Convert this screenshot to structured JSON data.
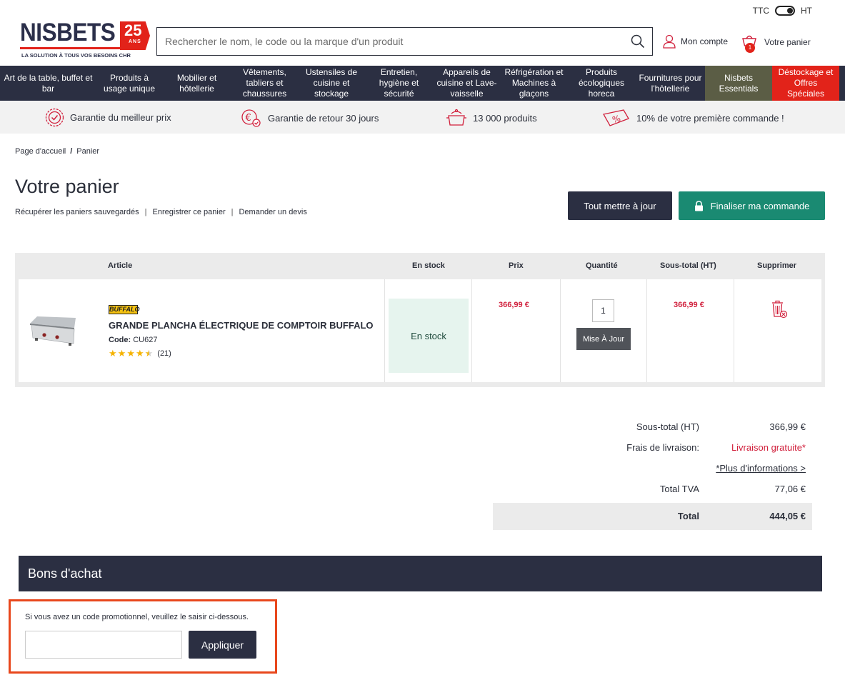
{
  "header": {
    "tax_ttc": "TTC",
    "tax_ht": "HT",
    "logo_word": "NISBETS",
    "logo_badge_number": "25",
    "logo_badge_text": "ANS",
    "logo_tagline": "LA SOLUTION À TOUS VOS BESOINS CHR",
    "search_placeholder": "Rechercher le nom, le code ou la marque d'un produit",
    "account_label": "Mon compte",
    "cart_label": "Votre panier",
    "cart_count": "1"
  },
  "nav": {
    "items": [
      {
        "label": "Art de la table, buffet et bar"
      },
      {
        "label": "Produits à usage unique"
      },
      {
        "label": "Mobilier et hôtellerie"
      },
      {
        "label": "Vêtements, tabliers et chaussures"
      },
      {
        "label": "Ustensiles de cuisine et stockage"
      },
      {
        "label": "Entretien, hygiène et sécurité"
      },
      {
        "label": "Appareils de cuisine et Lave-vaisselle"
      },
      {
        "label": "Réfrigération et Machines à glaçons"
      },
      {
        "label": "Produits écologiques horeca"
      },
      {
        "label": "Fournitures pour l'hôtellerie"
      },
      {
        "label": "Nisbets Essentials"
      },
      {
        "label": "Déstockage et Offres Spéciales"
      }
    ]
  },
  "usp": [
    {
      "label": "Garantie du meilleur prix",
      "icon": "badge-check-icon"
    },
    {
      "label": "Garantie de retour 30 jours",
      "icon": "euro-return-icon"
    },
    {
      "label": "13 000 produits",
      "icon": "pot-icon"
    },
    {
      "label": "10% de votre première commande !",
      "icon": "percent-tag-icon"
    }
  ],
  "breadcrumb": {
    "home": "Page d'accueil",
    "sep": "/",
    "current": "Panier"
  },
  "page": {
    "title": "Votre panier",
    "link_saved": "Récupérer les paniers sauvegardés",
    "link_save": "Enregistrer ce panier",
    "link_quote": "Demander un devis",
    "link_sep": "|",
    "btn_update_all": "Tout mettre à jour",
    "btn_checkout": "Finaliser ma commande"
  },
  "table": {
    "headers": {
      "article": "Article",
      "stock": "En stock",
      "price": "Prix",
      "qty": "Quantité",
      "subtotal": "Sous-total (HT)",
      "remove": "Supprimer"
    },
    "rows": [
      {
        "brand": "BUFFALO",
        "name": "GRANDE PLANCHA ÉLECTRIQUE DE COMPTOIR BUFFALO",
        "code_label": "Code:",
        "code": "CU627",
        "rating": 4.5,
        "reviews": "(21)",
        "stock": "En stock",
        "price": "366,99 €",
        "qty": "1",
        "update_label": "Mise À Jour",
        "subtotal": "366,99 €"
      }
    ]
  },
  "totals": {
    "subtotal_label": "Sous-total (HT)",
    "subtotal_value": "366,99 €",
    "shipping_label": "Frais de livraison:",
    "shipping_value": "Livraison gratuite*",
    "more_info": "*Plus d'informations >",
    "vat_label": "Total TVA",
    "vat_value": "77,06 €",
    "total_label": "Total",
    "total_value": "444,05 €"
  },
  "vouchers": {
    "title": "Bons d'achat",
    "message": "Si vous avez un code promotionnel, veuillez le saisir ci-dessous.",
    "input_value": "",
    "apply_label": "Appliquer"
  },
  "colors": {
    "navy": "#2b2f42",
    "red": "#e2231a",
    "green": "#1a8a72",
    "price_red": "#d1203c",
    "highlight_orange": "#e8471c"
  }
}
